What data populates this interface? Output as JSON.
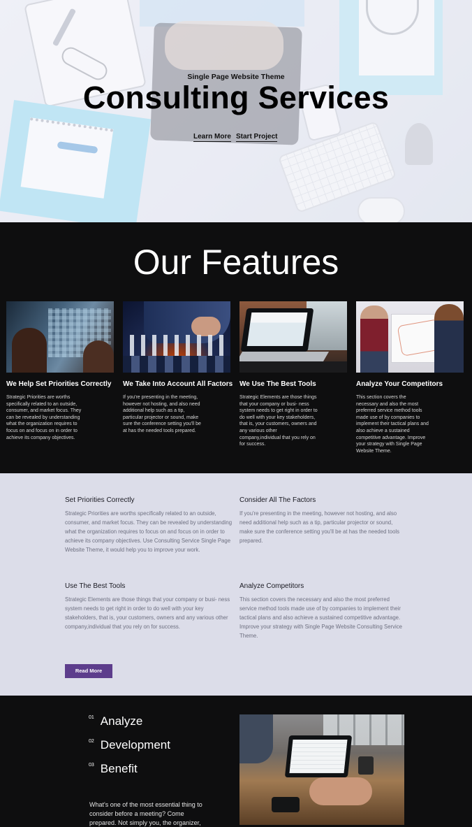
{
  "hero": {
    "kicker": "Single Page Website Theme",
    "title": "Consulting Services",
    "links": [
      "Learn More",
      "Start Project"
    ]
  },
  "features": {
    "heading": "Our Features",
    "cards": [
      {
        "title": "We Help Set Priorities Correctly",
        "text": "Strategic Priorities are worths specifically related to an outside, consumer, and market focus. They can be revealed by understanding what the organization requires to focus on and focus on in order to achieve its company objectives."
      },
      {
        "title": "We Take Into Account All Factors",
        "text": "If you're presenting in the meeting, however not hosting, and also need additional help such as a tip, particular projector or sound, make sure the conference setting you'll be at has the needed tools prepared."
      },
      {
        "title": "We Use The Best Tools",
        "text": "Strategic Elements are those things that your company or busi- ness system needs to get right in order to do well with your key stakeholders, that is, your customers, owners and any various other company,individual that you rely on for success."
      },
      {
        "title": "Analyze Your Competitors",
        "text": "This section covers the necessary and also the most preferred service method tools made use of by companies to implement their tactical plans and also achieve a sustained competitive advantage. Improve your strategy with Single Page Website Theme."
      }
    ]
  },
  "details": {
    "blocks": [
      {
        "title": "Set Priorities Correctly",
        "text": "Strategic Priorities are worths specifically related to an outside, consumer, and market focus. They can be revealed by understanding what the organization requires to focus on and focus on in order to achieve its company objectives. Use Consulting Service Single Page Website Theme, it would help you to improve your work."
      },
      {
        "title": "Consider All The Factors",
        "text": "If you're presenting in the meeting, however not hosting, and also need additional help such as a tip, particular projector or sound, make sure the conference setting you'll be at has the needed tools prepared."
      },
      {
        "title": "Use The Best Tools",
        "text": "Strategic Elements are those things that your company or busi- ness system needs to get right in order to do well with your key stakeholders, that is, your customers, owners and any various other company,individual that you rely on for success."
      },
      {
        "title": "Analyze Competitors",
        "text": "This section covers the necessary and also the most preferred service method tools made use of by companies to implement their tactical plans and also achieve a sustained competitive advantage. Improve your strategy with Single Page Website Consulting Service Theme."
      }
    ],
    "button": "Read More"
  },
  "steps": {
    "items": [
      {
        "num": "01",
        "label": "Analyze"
      },
      {
        "num": "02",
        "label": "Development"
      },
      {
        "num": "03",
        "label": "Benefit"
      }
    ],
    "paragraph": "What's one of the most essential thing to consider before a meeting? Come prepared. Not simply you, the organizer,"
  },
  "colors": {
    "dark": "#0e0e0f",
    "details_bg": "#dcdde9",
    "button": "#5d3d8c"
  }
}
